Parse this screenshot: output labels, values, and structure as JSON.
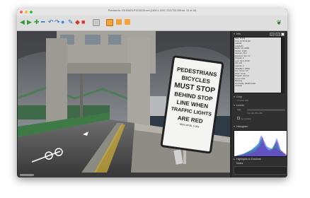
{
  "window": {
    "title": "Preview for 20190403-P1010019.nrd (1600 x 1200, 23/1/702.995 kb, 13 of 19)",
    "buttons": {
      "close": "#ff5f57",
      "minimize": "#ffbd2e",
      "zoom": "#28c840"
    }
  },
  "toolbar": {
    "tools": [
      {
        "icon": "arrow-left-icon",
        "glyph": "◀",
        "color": "#3a9a3a"
      },
      {
        "icon": "arrow-right-icon",
        "glyph": "▶",
        "color": "#3a9a3a"
      },
      {
        "icon": "add-icon",
        "glyph": "✚",
        "color": "#3a9a3a"
      },
      {
        "icon": "remove-icon",
        "glyph": "━",
        "color": "#1f6fc8"
      },
      {
        "icon": "rotate-left-icon",
        "glyph": "↶",
        "color": "#1f6fc8"
      },
      {
        "icon": "rotate-right-icon",
        "glyph": "↷",
        "color": "#1f6fc8"
      },
      {
        "icon": "info-icon",
        "glyph": "●",
        "color": "#2b8be0"
      },
      {
        "icon": "edit-icon",
        "glyph": "✎",
        "color": "#1f6fc8"
      },
      {
        "icon": "tag-icon",
        "glyph": "◆",
        "color": "#d8342a"
      },
      {
        "icon": "trash-icon",
        "glyph": "■",
        "color": "#d8342a"
      }
    ],
    "view_modes": [
      {
        "icon": "single-view-icon",
        "color": "#f2a33a"
      },
      {
        "icon": "compare-view-icon",
        "color": "#f2a33a"
      },
      {
        "icon": "film-view-icon",
        "color": "#f2a33a"
      },
      {
        "icon": "grid-view-icon",
        "color": "#f2a33a"
      }
    ],
    "app_logo": "leaf-icon"
  },
  "photo": {
    "sign_lines": [
      "PEDESTRIANS",
      "BICYCLES",
      "MUST STOP",
      "BEHIND STOP",
      "LINE WHEN",
      "TRAFFIC LIGHTS",
      "ARE RED"
    ],
    "sign_fine_print": "MCN  ##  BL 3 293"
  },
  "panel": {
    "sections": {
      "info": "Info",
      "crop": "Crop",
      "levels": "Levels",
      "histogram": "Histogram",
      "highlights": "Highlights & Shadows",
      "notes": "Notes"
    },
    "info_lines": [
      "Date: 3/4/19",
      "Time: 12:53:54 AM",
      "Latitude:",
      "Longitude:",
      "Model: DC-G90M",
      "Shutter: 1/400",
      "Aperture: f/4.0",
      "Exposure: Std. 1.0",
      "Program: 0",
      "Lens: Sony 16-50",
      "ISO: 200",
      "Aperture: 4",
      "WhiteBal: 1 (Wbb)",
      "Exp. Comp.: 0.0",
      "Flash: Comp.",
      "Program: Normal",
      "Focus mode",
      "Metering",
      "ICC Profile: sRGB Profile",
      "Contrast"
    ],
    "crop_values": "0  0  1600  1200",
    "levels_label": "Gray",
    "levels_values": "0  10  100  255  0  255",
    "live_scrolling": "Live scrolling"
  }
}
